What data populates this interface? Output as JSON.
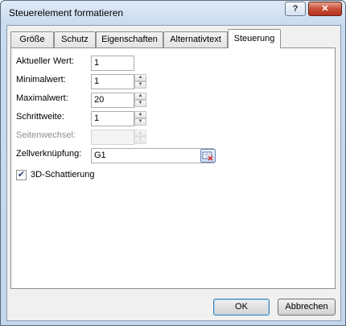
{
  "window": {
    "title": "Steuerelement formatieren",
    "help_label": "?",
    "close_label": "✕"
  },
  "tabs": [
    {
      "label": "Größe"
    },
    {
      "label": "Schutz"
    },
    {
      "label": "Eigenschaften"
    },
    {
      "label": "Alternativtext"
    },
    {
      "label": "Steuerung",
      "active": true
    }
  ],
  "fields": {
    "current_value": {
      "label": "Aktueller Wert:",
      "value": "1"
    },
    "min_value": {
      "label": "Minimalwert:",
      "value": "1"
    },
    "max_value": {
      "label": "Maximalwert:",
      "value": "20"
    },
    "step": {
      "label": "Schrittweite:",
      "value": "1"
    },
    "page_change": {
      "label": "Seitenwechsel:",
      "value": ""
    },
    "cell_link": {
      "label": "Zellverknüpfung:",
      "value": "G1"
    }
  },
  "shading": {
    "label": "3D-Schattierung",
    "checked": true
  },
  "buttons": {
    "ok": "OK",
    "cancel": "Abbrechen"
  },
  "icons": {
    "spin_up": "up-arrow-icon",
    "spin_down": "down-arrow-icon",
    "ref": "cell-reference-icon"
  }
}
